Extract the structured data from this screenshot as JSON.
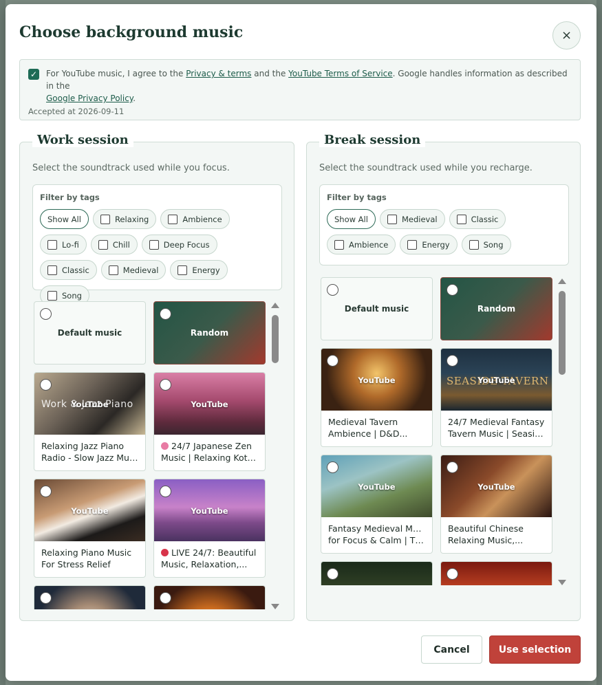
{
  "dialog": {
    "title": "Choose background music",
    "close_symbol": "×"
  },
  "consent": {
    "prefix": "For YouTube music, I agree to the ",
    "privacy_link": "Privacy & terms",
    "mid": " and the ",
    "yt_link": "YouTube Terms of Service",
    "mid2": ". Google handles information as described in the ",
    "google_link": "Google Privacy Policy",
    "suffix": ".",
    "accepted": "Accepted at 2026-09-11",
    "checked": true
  },
  "work": {
    "title": "Work session",
    "description": "Select the soundtrack used while you focus.",
    "filter_label": "Filter by tags",
    "tags": [
      "Show All",
      "Relaxing",
      "Ambience",
      "Lo-fi",
      "Chill",
      "Deep Focus",
      "Classic",
      "Medieval",
      "Energy",
      "Song"
    ],
    "default_label": "Default music",
    "random_label": "Random",
    "youtube_label": "YouTube",
    "cards": [
      {
        "line1": "Relaxing Jazz Piano",
        "line2": "Radio - Slow Jazz Musi...",
        "overlay": "Work & Jazz Piano"
      },
      {
        "line1": "24/7 Japanese Zen",
        "line2": "Music | Relaxing Koto ...",
        "emoji": "flower-icon"
      },
      {
        "line1": "Relaxing Piano Music",
        "line2": "For Stress Relief"
      },
      {
        "line1": "LIVE 24/7: Beautiful",
        "line2": "Music, Relaxation,...",
        "emoji": "red-dot-icon"
      }
    ]
  },
  "break": {
    "title": "Break session",
    "description": "Select the soundtrack used while you recharge.",
    "filter_label": "Filter by tags",
    "tags": [
      "Show All",
      "Medieval",
      "Classic",
      "Ambience",
      "Energy",
      "Song"
    ],
    "default_label": "Default music",
    "random_label": "Random",
    "youtube_label": "YouTube",
    "cards": [
      {
        "line1": "Medieval Tavern",
        "line2": "Ambience | D&D..."
      },
      {
        "line1": "24/7 Medieval Fantasy",
        "line2": "Tavern Music | Seasid...",
        "overlay": "SEASIDE TAVERN"
      },
      {
        "line1": "Fantasy Medieval Music",
        "line2": "for Focus & Calm | Th..."
      },
      {
        "line1": "Beautiful Chinese",
        "line2": "Relaxing Music,..."
      }
    ]
  },
  "footer": {
    "cancel": "Cancel",
    "use": "Use selection"
  },
  "colors": {
    "accent": "#1e6b56",
    "primary_button": "#c0423a"
  }
}
